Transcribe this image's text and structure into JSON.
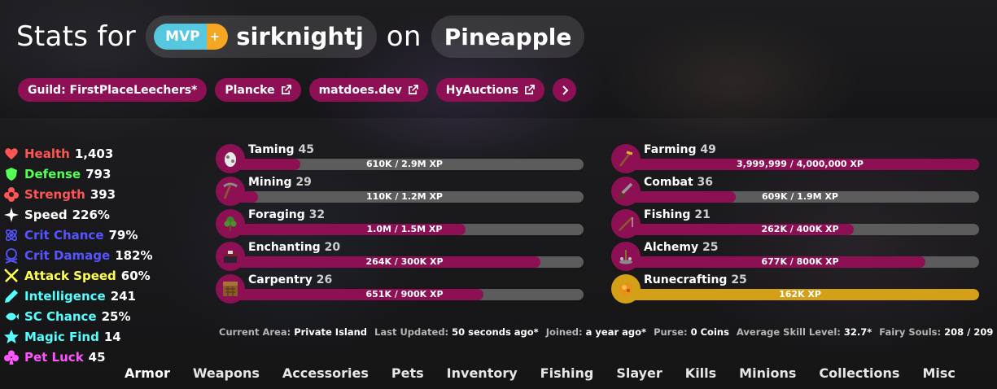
{
  "header": {
    "prefix": "Stats for",
    "rank_mvp": "MVP",
    "rank_plus": "+",
    "username": "sirknightj",
    "on": "on",
    "profile": "Pineapple"
  },
  "links": [
    {
      "label": "Guild: FirstPlaceLeechers*",
      "external": false
    },
    {
      "label": "Plancke",
      "external": true
    },
    {
      "label": "matdoes.dev",
      "external": true
    },
    {
      "label": "HyAuctions",
      "external": true
    }
  ],
  "more_icon": "chevron-right-icon",
  "stats": [
    {
      "name": "Health",
      "value": "1,403",
      "color": "#ff5555",
      "icon": "heart-icon"
    },
    {
      "name": "Defense",
      "value": "793",
      "color": "#55ff55",
      "icon": "shield-icon"
    },
    {
      "name": "Strength",
      "value": "393",
      "color": "#ff5555",
      "icon": "flower-icon"
    },
    {
      "name": "Speed",
      "value": "226%",
      "color": "#ffffff",
      "icon": "sparkle-icon"
    },
    {
      "name": "Crit Chance",
      "value": "79%",
      "color": "#5555ff",
      "icon": "atom-icon"
    },
    {
      "name": "Crit Damage",
      "value": "182%",
      "color": "#5555ff",
      "icon": "skull-icon"
    },
    {
      "name": "Attack Speed",
      "value": "60%",
      "color": "#ffff55",
      "icon": "crossed-swords-icon"
    },
    {
      "name": "Intelligence",
      "value": "241",
      "color": "#55ffff",
      "icon": "pencil-icon"
    },
    {
      "name": "SC Chance",
      "value": "25%",
      "color": "#55ffff",
      "icon": "fish-icon"
    },
    {
      "name": "Magic Find",
      "value": "14",
      "color": "#55ffff",
      "icon": "star-icon"
    },
    {
      "name": "Pet Luck",
      "value": "45",
      "color": "#ff55ff",
      "icon": "club-icon"
    }
  ],
  "skills_left": [
    {
      "name": "Taming",
      "level": "45",
      "xp": "610K / 2.9M XP",
      "progress": 0.21,
      "icon": "spawn-egg-icon"
    },
    {
      "name": "Mining",
      "level": "29",
      "xp": "110K / 1.2M XP",
      "progress": 0.09,
      "icon": "pickaxe-icon"
    },
    {
      "name": "Foraging",
      "level": "32",
      "xp": "1.0M / 1.5M XP",
      "progress": 0.67,
      "icon": "sapling-icon"
    },
    {
      "name": "Enchanting",
      "level": "20",
      "xp": "264K / 300K XP",
      "progress": 0.88,
      "icon": "enchanting-table-icon"
    },
    {
      "name": "Carpentry",
      "level": "26",
      "xp": "651K / 900K XP",
      "progress": 0.72,
      "icon": "crafting-table-icon"
    }
  ],
  "skills_right": [
    {
      "name": "Farming",
      "level": "49",
      "xp": "3,999,999 / 4,000,000 XP",
      "progress": 0.999,
      "icon": "hoe-icon",
      "gold": false
    },
    {
      "name": "Combat",
      "level": "36",
      "xp": "609K / 1.9M XP",
      "progress": 0.32,
      "icon": "sword-icon",
      "gold": false
    },
    {
      "name": "Fishing",
      "level": "21",
      "xp": "262K / 400K XP",
      "progress": 0.65,
      "icon": "fishing-rod-icon",
      "gold": false
    },
    {
      "name": "Alchemy",
      "level": "25",
      "xp": "677K / 800K XP",
      "progress": 0.85,
      "icon": "brewing-stand-icon",
      "gold": false
    },
    {
      "name": "Runecrafting",
      "level": "25",
      "xp": "162K XP",
      "progress": 1.0,
      "icon": "magma-cream-icon",
      "gold": true
    }
  ],
  "info": [
    {
      "label": "Current Area:",
      "value": "Private Island"
    },
    {
      "label": "Last Updated:",
      "value": "50 seconds ago*"
    },
    {
      "label": "Joined:",
      "value": "a year ago*"
    },
    {
      "label": "Purse:",
      "value": "0 Coins"
    },
    {
      "label": "Average Skill Level:",
      "value": "32.7*"
    },
    {
      "label": "Fairy Souls:",
      "value": "208 / 209"
    }
  ],
  "nav": [
    "Armor",
    "Weapons",
    "Accessories",
    "Pets",
    "Inventory",
    "Fishing",
    "Slayer",
    "Kills",
    "Minions",
    "Collections",
    "Misc"
  ],
  "colors": {
    "accent": "#8e1054",
    "gold": "#d4a017",
    "mvp": "#55c8e0",
    "plus": "#f5a623"
  }
}
